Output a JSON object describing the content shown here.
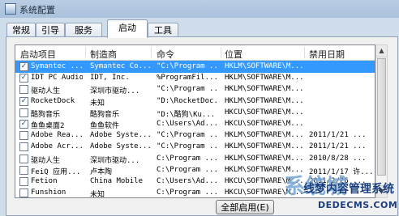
{
  "window": {
    "title": "系统配置"
  },
  "tabs": [
    "常规",
    "引导",
    "服务",
    "启动",
    "工具"
  ],
  "active_tab": "启动",
  "columns": [
    "启动项目",
    "制造商",
    "命令",
    "位置",
    "禁用日期"
  ],
  "rows": [
    {
      "checked": true,
      "item": "Symantec ...",
      "maker": "Symantec Co...",
      "command": "\"C:\\Program ...",
      "location": "HKLM\\SOFTWARE\\M...",
      "date": ""
    },
    {
      "checked": true,
      "item": "IDT PC Audio",
      "maker": "IDT, Inc.",
      "command": "%ProgramFil...",
      "location": "HKLM\\SOFTWARE\\M...",
      "date": ""
    },
    {
      "checked": false,
      "item": "驱动人生",
      "maker": "深圳市驱动...",
      "command": "\"C:\\Program ...",
      "location": "HKLM\\SOFTWARE\\M...",
      "date": ""
    },
    {
      "checked": true,
      "item": "RocketDock",
      "maker": "未知",
      "command": "\"D:\\RocketDoc...",
      "location": "HKLM\\SOFTWARE\\M...",
      "date": ""
    },
    {
      "checked": false,
      "item": "酷狗音乐",
      "maker": "酷狗音乐",
      "command": "\"D:\\酷狗\\Ku...",
      "location": "HKCU\\SOFTWARE\\M...",
      "date": ""
    },
    {
      "checked": true,
      "item": "鱼鱼桌面2",
      "maker": "鱼鱼软件",
      "command": "C:\\Users\\Ad...",
      "location": "HKCU\\SOFTWARE\\M...",
      "date": ""
    },
    {
      "checked": false,
      "item": "Adobe Rea...",
      "maker": "Adobe Syste...",
      "command": "\"C:\\Program ...",
      "location": "HKLM\\SOFTWARE\\M...",
      "date": "2011/1/21 ..."
    },
    {
      "checked": false,
      "item": "Adobe Acr...",
      "maker": "Adobe Syste...",
      "command": "\"C:\\Program ...",
      "location": "HKLM\\SOFTWARE\\M...",
      "date": "2011/1/21 ..."
    },
    {
      "checked": false,
      "item": "驱动人生",
      "maker": "深圳市驱动...",
      "command": "C:\\Program ...",
      "location": "HKLM\\SOFTWARE\\M...",
      "date": "2010/8/28 ..."
    },
    {
      "checked": false,
      "item": "FeiQ 应用...",
      "maker": "卢本陶",
      "command": "C:\\Program ...",
      "location": "HKLM\\SOFTWARE\\M...",
      "date": "2011/1/17 许..."
    },
    {
      "checked": false,
      "item": "Fetion",
      "maker": "China Mobile",
      "command": "C:\\Users\\Ad...",
      "location": "HKCU\\SOFTWARE\\M...",
      "date": "2011/2/26 ..."
    },
    {
      "checked": false,
      "item": "Funshion",
      "maker": "未知",
      "command": "C:\\Program ...",
      "location": "HKCU\\SOFTWARE\\M...",
      "date": ""
    }
  ],
  "selected_row": 0,
  "buttons": {
    "enable_all": "全部启用(E)"
  },
  "watermark": {
    "logo": "系统城",
    "text1": "线梦内容管理系统",
    "text2": "DEDECMS.COM"
  }
}
